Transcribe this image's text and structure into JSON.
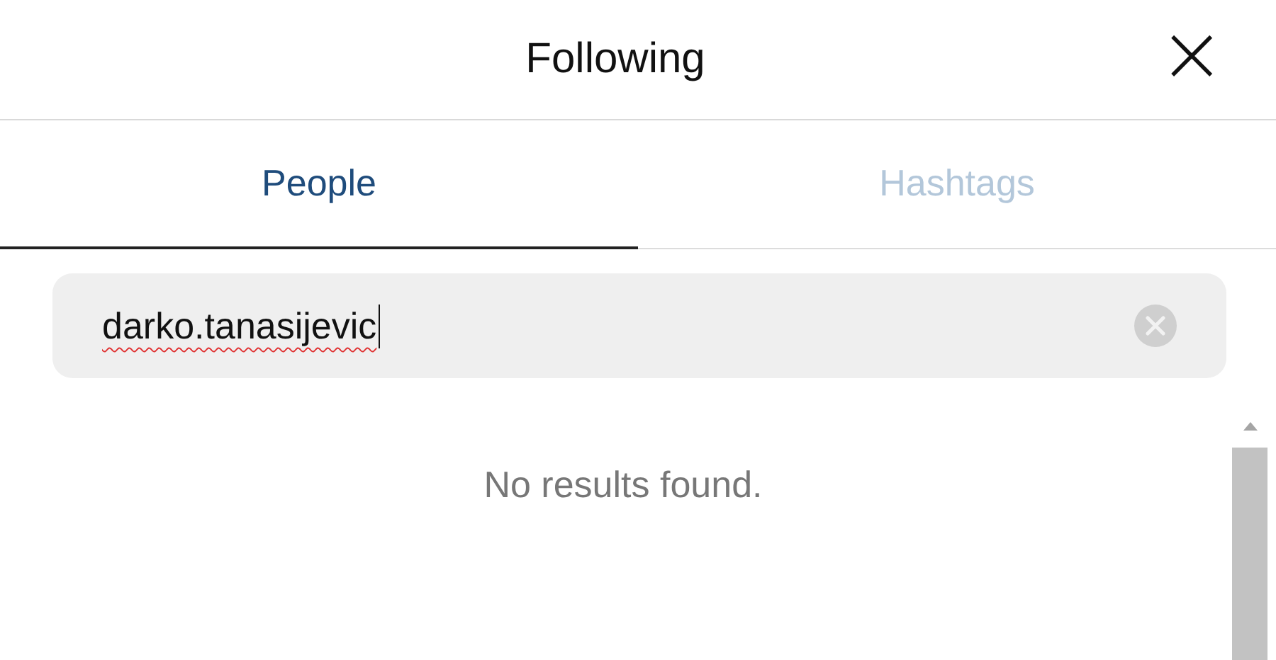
{
  "window": {
    "title": "Following",
    "close": "×"
  },
  "tabs": [
    {
      "label": "People",
      "selected": true
    },
    {
      "label": "Hashtags",
      "selected": false
    }
  ],
  "search": {
    "value": "darko.tanasijevic",
    "misspelled": true
  },
  "message": "No results found."
}
